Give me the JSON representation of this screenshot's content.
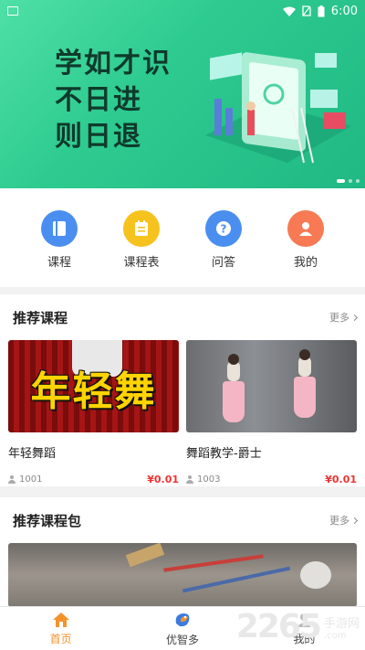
{
  "status_bar": {
    "time": "6:00"
  },
  "banner": {
    "lines": [
      "学如才识",
      "不日进",
      "则日退"
    ],
    "slides": 3,
    "active_slide": 1,
    "colors": {
      "start": "#4fe0a6",
      "end": "#20b884"
    }
  },
  "quick_menu": [
    {
      "label": "课程",
      "icon": "book-icon",
      "color": "#4a8ff0"
    },
    {
      "label": "课程表",
      "icon": "schedule-icon",
      "color": "#f6c21d"
    },
    {
      "label": "问答",
      "icon": "question-icon",
      "color": "#4a8ff0"
    },
    {
      "label": "我的",
      "icon": "user-icon",
      "color": "#f77a55"
    }
  ],
  "recommended_courses": {
    "title": "推荐课程",
    "more": "更多",
    "items": [
      {
        "thumb_text": "年轻舞",
        "title": "年轻舞蹈",
        "students": "1001",
        "price": "¥0.01"
      },
      {
        "title": "舞蹈教学-爵士",
        "students": "1003",
        "price": "¥0.01"
      }
    ]
  },
  "recommended_packages": {
    "title": "推荐课程包",
    "more": "更多"
  },
  "tabbar": [
    {
      "label": "首页",
      "icon": "home-icon",
      "active": true
    },
    {
      "label": "优智多",
      "icon": "bird-logo-icon",
      "active": false
    },
    {
      "label": "我的",
      "icon": "profile-icon",
      "active": false
    }
  ],
  "watermark": {
    "number": "2265",
    "text": "手游网",
    "domain": ".com"
  }
}
